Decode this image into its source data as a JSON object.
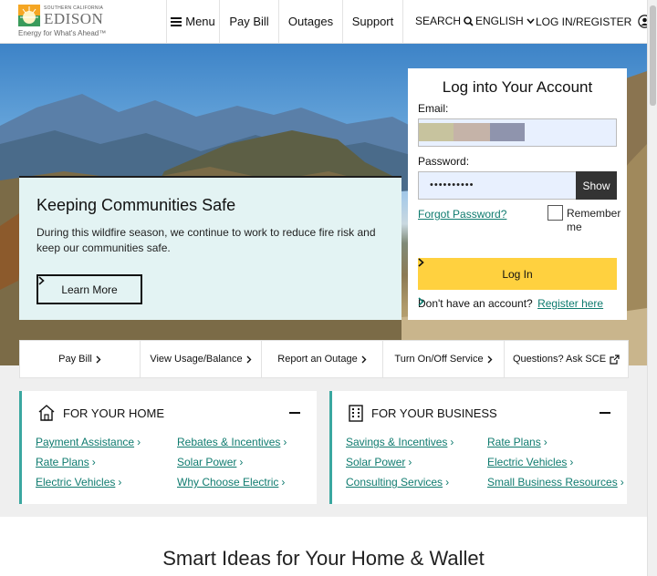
{
  "header": {
    "logo_small": "SOUTHERN CALIFORNIA",
    "logo_brand": "EDISON",
    "logo_tagline": "Energy for What's Ahead™",
    "menu_label": "Menu",
    "nav": [
      "Pay Bill",
      "Outages",
      "Support"
    ],
    "search_label": "SEARCH",
    "language_label": "ENGLISH",
    "login_label": "LOG IN/REGISTER"
  },
  "hero_card": {
    "title": "Keeping Communities Safe",
    "body": "During this wildfire season, we continue to work to reduce fire risk and keep our communities safe.",
    "button": "Learn More"
  },
  "login": {
    "title": "Log into Your Account",
    "email_label": "Email:",
    "password_label": "Password:",
    "password_value": "••••••••••",
    "show_label": "Show",
    "forgot_label": "Forgot Password?",
    "remember_label": "Remember me",
    "login_button": "Log In",
    "no_account_text": "Don't have an account?",
    "register_label": "Register here"
  },
  "quick_links": [
    "Pay Bill",
    "View Usage/Balance",
    "Report an Outage",
    "Turn On/Off Service",
    "Questions? Ask SCE"
  ],
  "home_panel": {
    "title": "FOR YOUR HOME",
    "links_left": [
      "Payment Assistance",
      "Rate Plans",
      "Electric Vehicles"
    ],
    "links_right": [
      "Rebates & Incentives",
      "Solar Power",
      "Why Choose Electric"
    ]
  },
  "business_panel": {
    "title": "FOR YOUR BUSINESS",
    "links_left": [
      "Savings & Incentives",
      "Solar Power",
      "Consulting Services"
    ],
    "links_right": [
      "Rate Plans",
      "Electric Vehicles",
      "Small Business Resources"
    ]
  },
  "section_heading": "Smart Ideas for Your Home & Wallet",
  "colors": {
    "link_teal": "#0f7b6f",
    "accent_yellow": "#ffd13f",
    "panel_border": "#3aa7a0",
    "hero_card_bg": "#e3f3f3"
  }
}
